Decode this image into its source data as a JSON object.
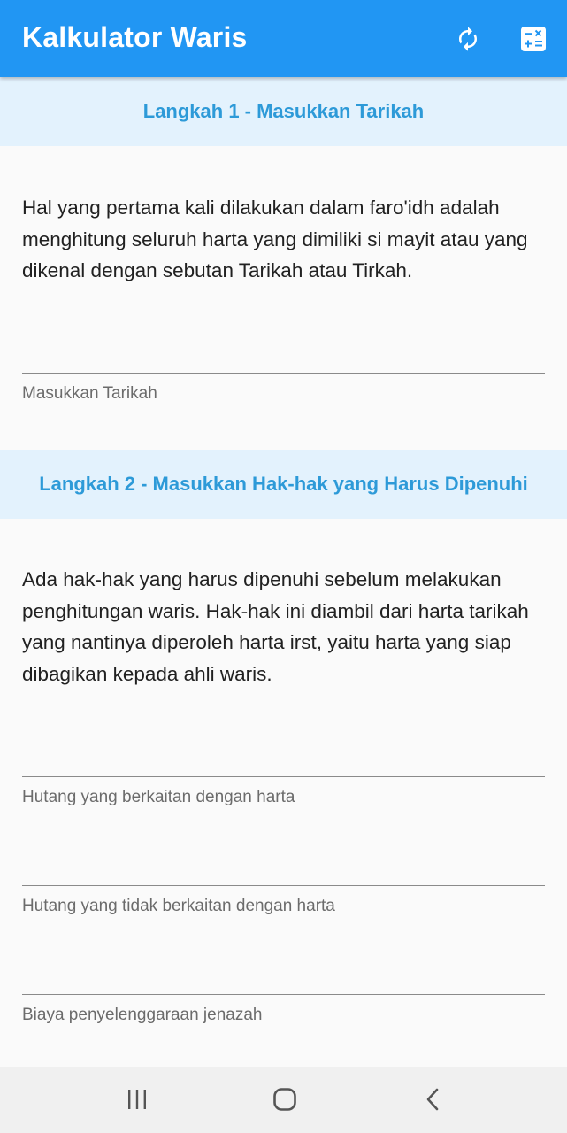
{
  "appbar": {
    "title": "Kalkulator Waris",
    "color": "#2196f3",
    "actions": [
      {
        "icon": "refresh-icon"
      },
      {
        "icon": "calculator-icon"
      }
    ]
  },
  "step1": {
    "title": "Langkah 1 - Masukkan Tarikah",
    "description": "Hal yang pertama kali dilakukan dalam faro'idh adalah menghitung seluruh harta yang dimiliki si mayit atau yang dikenal dengan sebutan Tarikah atau Tirkah.",
    "fields": [
      {
        "label": "Masukkan Tarikah",
        "value": ""
      }
    ]
  },
  "step2": {
    "title": "Langkah 2 - Masukkan Hak-hak yang Harus Dipenuhi",
    "description": "Ada hak-hak yang harus dipenuhi sebelum melakukan penghitungan waris. Hak-hak ini diambil dari harta tarikah yang nantinya diperoleh harta irst, yaitu harta yang siap dibagikan kepada ahli waris.",
    "fields": [
      {
        "label": "Hutang yang berkaitan dengan harta",
        "value": ""
      },
      {
        "label": "Hutang yang tidak berkaitan dengan harta",
        "value": ""
      },
      {
        "label": "Biaya penyelenggaraan jenazah",
        "value": ""
      }
    ]
  },
  "navbar": {
    "buttons": [
      {
        "icon": "recent-apps-icon"
      },
      {
        "icon": "home-icon"
      },
      {
        "icon": "back-icon"
      }
    ]
  },
  "colors": {
    "primary": "#2196f3",
    "step_header_bg": "#e3f2fd",
    "step_header_text": "#2d9ad8"
  }
}
